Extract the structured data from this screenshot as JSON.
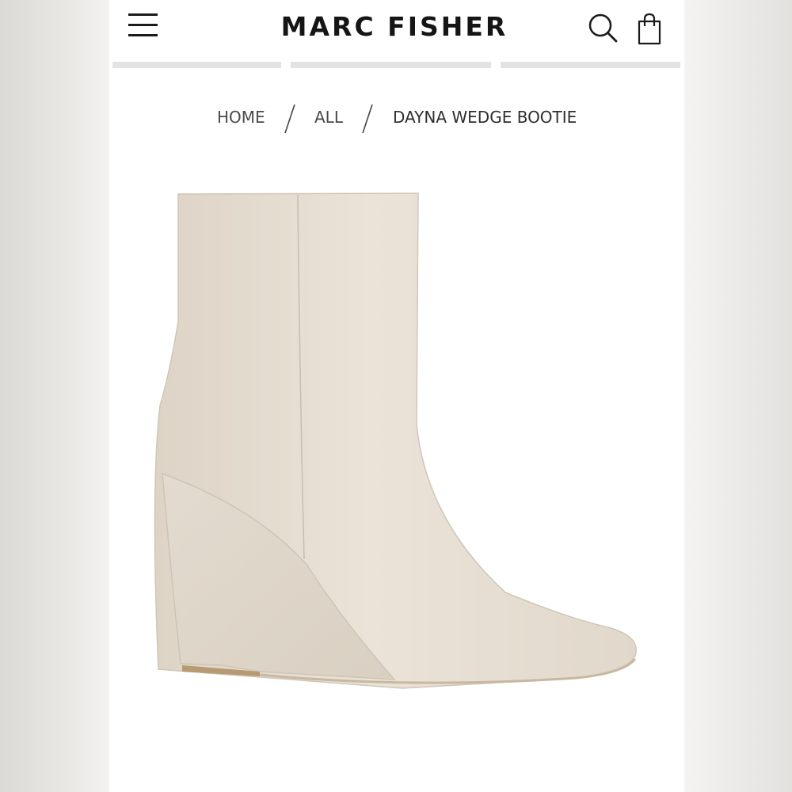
{
  "header": {
    "brand": "MARC FISHER",
    "menu_icon": "hamburger-menu-icon",
    "search_icon": "search-icon",
    "bag_icon": "shopping-bag-icon"
  },
  "nav_tabs": {
    "count": 3
  },
  "breadcrumb": {
    "items": [
      "HOME",
      "ALL"
    ],
    "current": "DAYNA WEDGE BOOTIE",
    "separator": "/"
  },
  "product": {
    "image": "cream leather pointed-toe wedge ankle bootie",
    "color": "#e6ddd1"
  }
}
